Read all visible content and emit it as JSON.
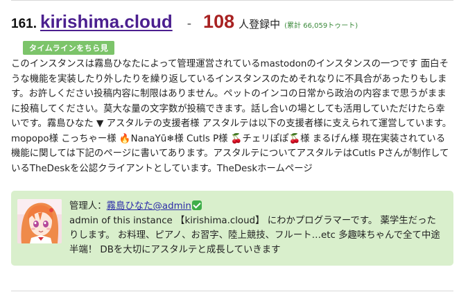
{
  "instance": {
    "rank": "161.",
    "name": "kirishima.cloud",
    "separator": "-",
    "users_count": "108",
    "users_suffix": "人登録中",
    "toots": "(累計 66,059トゥート)",
    "timeline_button": "タイムラインをちら見",
    "description": "このインスタンスは霧島ひなたによって管理運営されているmastodonのインスタンスの一つです 面白そうな機能を実装したり外したりを繰り返しているインスタンスのためそれなりに不具合があったりもします。お許しください投稿内容に制限はありません。ペットのインコの日常から政治の内容まで思うがままに投稿してください。莫大な量の文字数が投稿できます。話し合いの場としても活用していただけたら幸いです。霧島ひなた ▼ アスタルテの支援者様 アスタルテは以下の支援者様に支えられて運営しています。 mopopo様 こっちゃー様 🔥NanaYū❄様 Cutls P様 🍒チェリぽぽ🍒様 まるげん様 現在実装されている機能に関しては下記のページに書いてあります。アスタルテについてアスタルテはCutls Pさんが制作しているTheDeskを公認クライアントとしています。TheDeskホームページ"
  },
  "admin": {
    "label": "管理人：",
    "name": "霧島ひなた@admin",
    "bio": "admin of this instance 【kirishima.cloud】 にわかプログラマーです。 薬学生だったりします。 お料理、ピアノ、お習字、陸上競技、フルート…etc 多趣味ちゃんで全て中途半端！ DBを大切にアスタルテと成長していきます",
    "verified_icon": "check-icon",
    "avatar_icon": "anime-avatar-icon"
  },
  "colors": {
    "instance_link": "#4b1f8f",
    "count": "#a82222",
    "toots": "#3b8a3b",
    "timeline_button": "#7cc46a",
    "admin_card": "#d9efcc",
    "admin_link": "#2a2aa8"
  }
}
